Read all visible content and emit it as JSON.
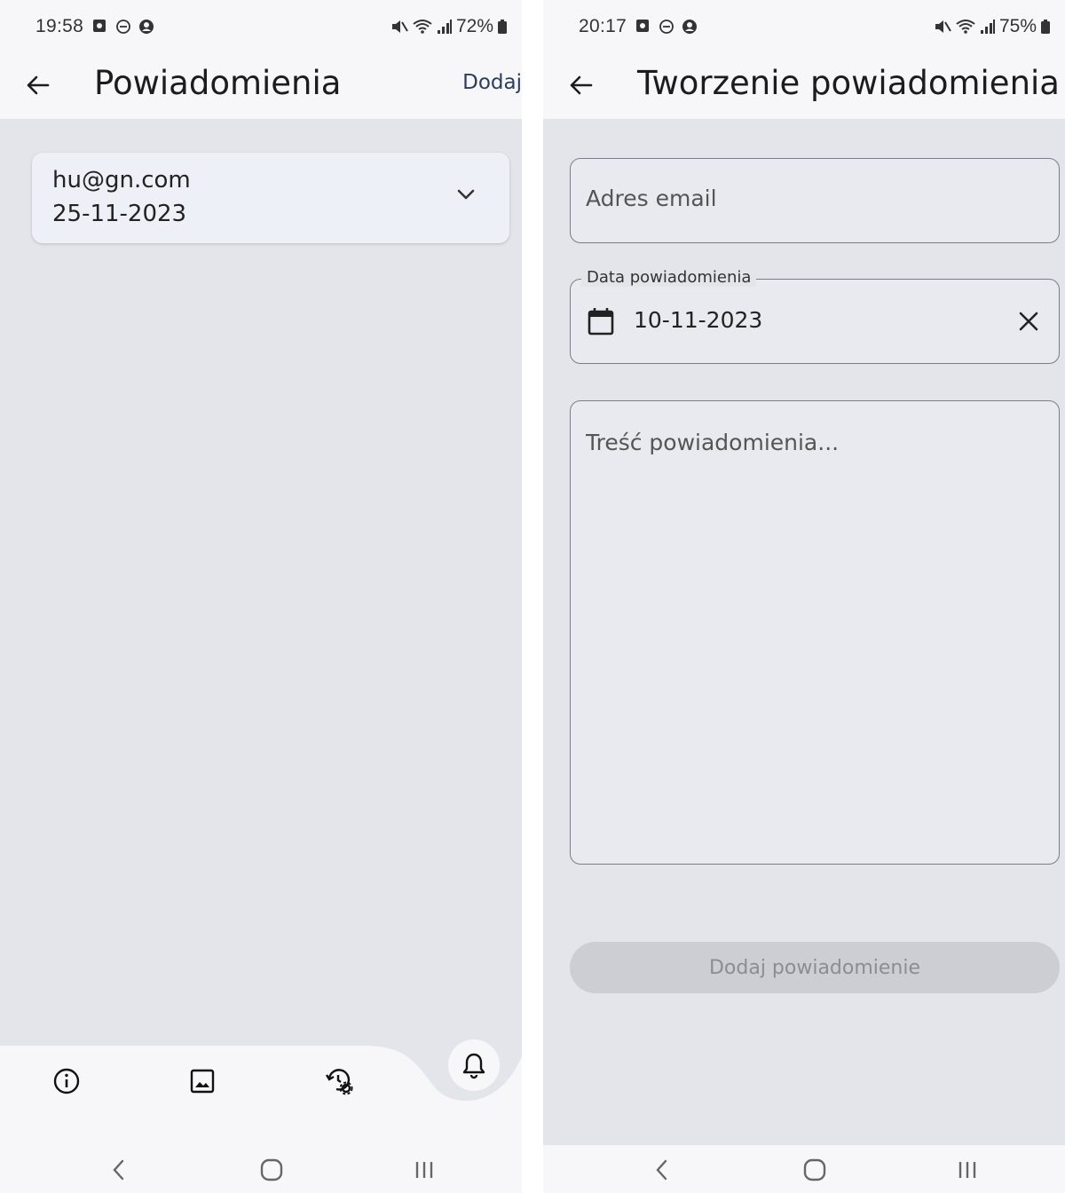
{
  "left": {
    "status": {
      "time": "19:58",
      "battery": "72%"
    },
    "appbar": {
      "title": "Powiadomienia",
      "action": "Dodaj"
    },
    "notifications": [
      {
        "email": "hu@gn.com",
        "date": "25-11-2023"
      }
    ],
    "bottom_nav": {
      "items": [
        {
          "icon": "info-icon"
        },
        {
          "icon": "image-icon"
        },
        {
          "icon": "history-settings-icon"
        },
        {
          "icon": "bell-icon",
          "active": true
        }
      ]
    }
  },
  "right": {
    "status": {
      "time": "20:17",
      "battery": "75%"
    },
    "appbar": {
      "title": "Tworzenie powiadomienia"
    },
    "form": {
      "email": {
        "placeholder": "Adres email",
        "value": ""
      },
      "date": {
        "label": "Data powiadomienia",
        "value": "10-11-2023"
      },
      "message": {
        "placeholder": "Treść powiadomienia...",
        "value": ""
      },
      "submit_label": "Dodaj powiadomienie"
    }
  },
  "colors": {
    "background": "#e4e5ea",
    "surface": "#f7f7fa",
    "card": "#eef0f7",
    "action_text": "#2b3f5c",
    "disabled_button": "#cdced3"
  }
}
